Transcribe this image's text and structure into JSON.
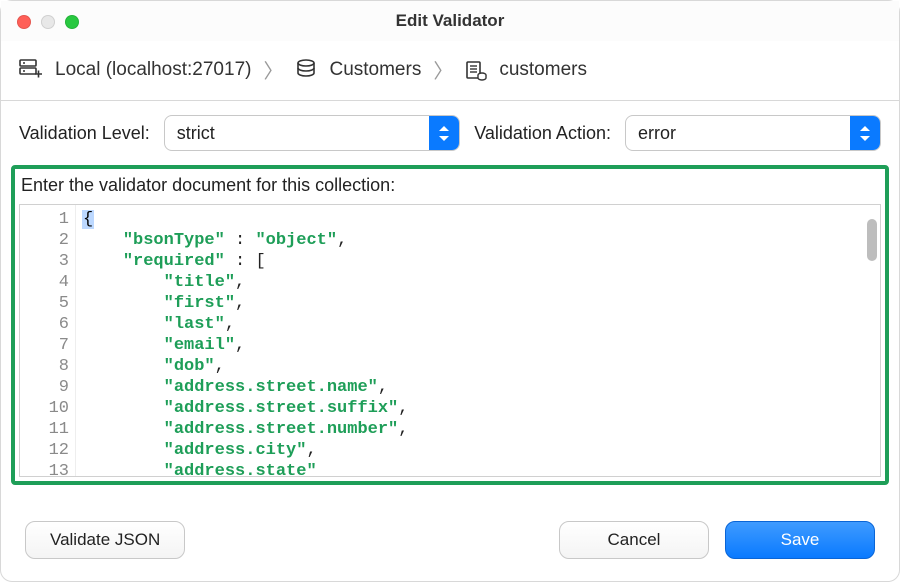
{
  "window": {
    "title": "Edit Validator"
  },
  "breadcrumb": {
    "connection": "Local (localhost:27017)",
    "database": "Customers",
    "collection": "customers"
  },
  "controls": {
    "level_label": "Validation Level:",
    "level_value": "strict",
    "action_label": "Validation Action:",
    "action_value": "error"
  },
  "editor": {
    "caption": "Enter the validator document for this collection:",
    "lines": [
      {
        "n": 1,
        "fold": true,
        "segments": [
          {
            "t": "{",
            "cls": "tok-brace"
          }
        ]
      },
      {
        "n": 2,
        "segments": [
          {
            "t": "    "
          },
          {
            "t": "\"bsonType\"",
            "cls": "tok-key"
          },
          {
            "t": " : "
          },
          {
            "t": "\"object\"",
            "cls": "tok-str"
          },
          {
            "t": ","
          }
        ]
      },
      {
        "n": 3,
        "fold": true,
        "segments": [
          {
            "t": "    "
          },
          {
            "t": "\"required\"",
            "cls": "tok-key"
          },
          {
            "t": " : ["
          }
        ]
      },
      {
        "n": 4,
        "segments": [
          {
            "t": "        "
          },
          {
            "t": "\"title\"",
            "cls": "tok-str"
          },
          {
            "t": ","
          }
        ]
      },
      {
        "n": 5,
        "segments": [
          {
            "t": "        "
          },
          {
            "t": "\"first\"",
            "cls": "tok-str"
          },
          {
            "t": ","
          }
        ]
      },
      {
        "n": 6,
        "segments": [
          {
            "t": "        "
          },
          {
            "t": "\"last\"",
            "cls": "tok-str"
          },
          {
            "t": ","
          }
        ]
      },
      {
        "n": 7,
        "segments": [
          {
            "t": "        "
          },
          {
            "t": "\"email\"",
            "cls": "tok-str"
          },
          {
            "t": ","
          }
        ]
      },
      {
        "n": 8,
        "segments": [
          {
            "t": "        "
          },
          {
            "t": "\"dob\"",
            "cls": "tok-str"
          },
          {
            "t": ","
          }
        ]
      },
      {
        "n": 9,
        "segments": [
          {
            "t": "        "
          },
          {
            "t": "\"address.street.name\"",
            "cls": "tok-str"
          },
          {
            "t": ","
          }
        ]
      },
      {
        "n": 10,
        "segments": [
          {
            "t": "        "
          },
          {
            "t": "\"address.street.suffix\"",
            "cls": "tok-str"
          },
          {
            "t": ","
          }
        ]
      },
      {
        "n": 11,
        "segments": [
          {
            "t": "        "
          },
          {
            "t": "\"address.street.number\"",
            "cls": "tok-str"
          },
          {
            "t": ","
          }
        ]
      },
      {
        "n": 12,
        "segments": [
          {
            "t": "        "
          },
          {
            "t": "\"address.city\"",
            "cls": "tok-str"
          },
          {
            "t": ","
          }
        ]
      },
      {
        "n": 13,
        "segments": [
          {
            "t": "        "
          },
          {
            "t": "\"address.state\"",
            "cls": "tok-str"
          }
        ]
      }
    ]
  },
  "footer": {
    "validate": "Validate JSON",
    "cancel": "Cancel",
    "save": "Save"
  }
}
